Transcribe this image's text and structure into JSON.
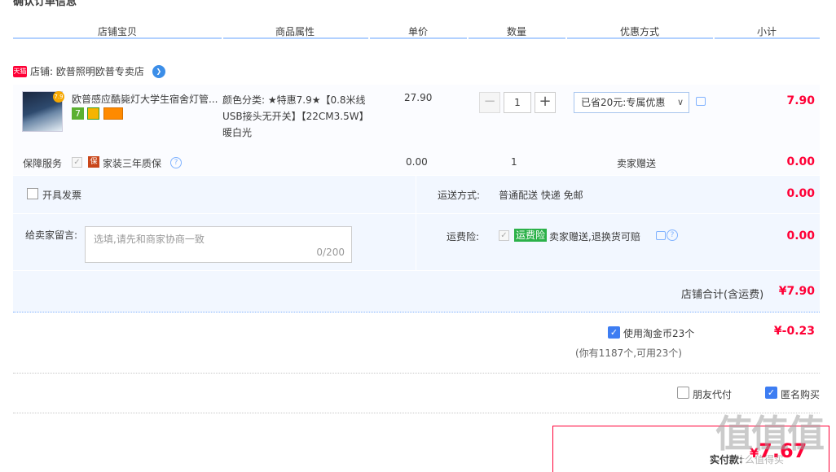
{
  "page": {
    "heading": "确认订单信息"
  },
  "columns": [
    "店铺宝贝",
    "商品属性",
    "单价",
    "数量",
    "优惠方式",
    "小计"
  ],
  "shop": {
    "badge": "天猫",
    "label": "店铺: 欧普照明欧普专卖店"
  },
  "item": {
    "title": "欧普感应酷毙灯大学生宿舍灯管...",
    "thumb_badge": "7.9",
    "badge_text": "7",
    "sku": "颜色分类: ★特惠7.9★【0.8米线USB接头无开关】【22CM3.5W】暖白光",
    "unit_price": "27.90",
    "quantity": "1",
    "minus": "−",
    "plus": "+",
    "discount": "已省20元:专属优惠",
    "subtotal": "7.90"
  },
  "service": {
    "label": "保障服务",
    "icon_text": "保",
    "name": "家装三年质保",
    "price": "0.00",
    "quantity": "1",
    "gift": "卖家赠送",
    "subtotal": "0.00"
  },
  "invoice": {
    "label": "开具发票"
  },
  "shipping": {
    "label": "运送方式:",
    "value": "普通配送 快递 免邮",
    "price": "0.00"
  },
  "message": {
    "label": "给卖家留言:",
    "placeholder": "选填,请先和商家协商一致",
    "count": "0/200"
  },
  "insurance": {
    "label": "运费险:",
    "badge": "运费险",
    "text": "卖家赠送,退换货可赔",
    "price": "0.00"
  },
  "shop_total": {
    "label": "店铺合计(含运费)",
    "value": "¥7.90"
  },
  "coin": {
    "label": "使用淘金币23个",
    "value": "¥-0.23",
    "note": "(你有1187个,可用23个)"
  },
  "options": {
    "friend_pay": "朋友代付",
    "anonymous": "匿名购买"
  },
  "payment": {
    "label": "实付款:",
    "currency": "¥",
    "value": "7.67"
  },
  "watermark": {
    "main": "值值值",
    "sub": "什么值得买"
  },
  "colors": {
    "accent_red": "#ff0036",
    "header_line": "#b2d1ff",
    "check_blue": "#3d7df2"
  }
}
